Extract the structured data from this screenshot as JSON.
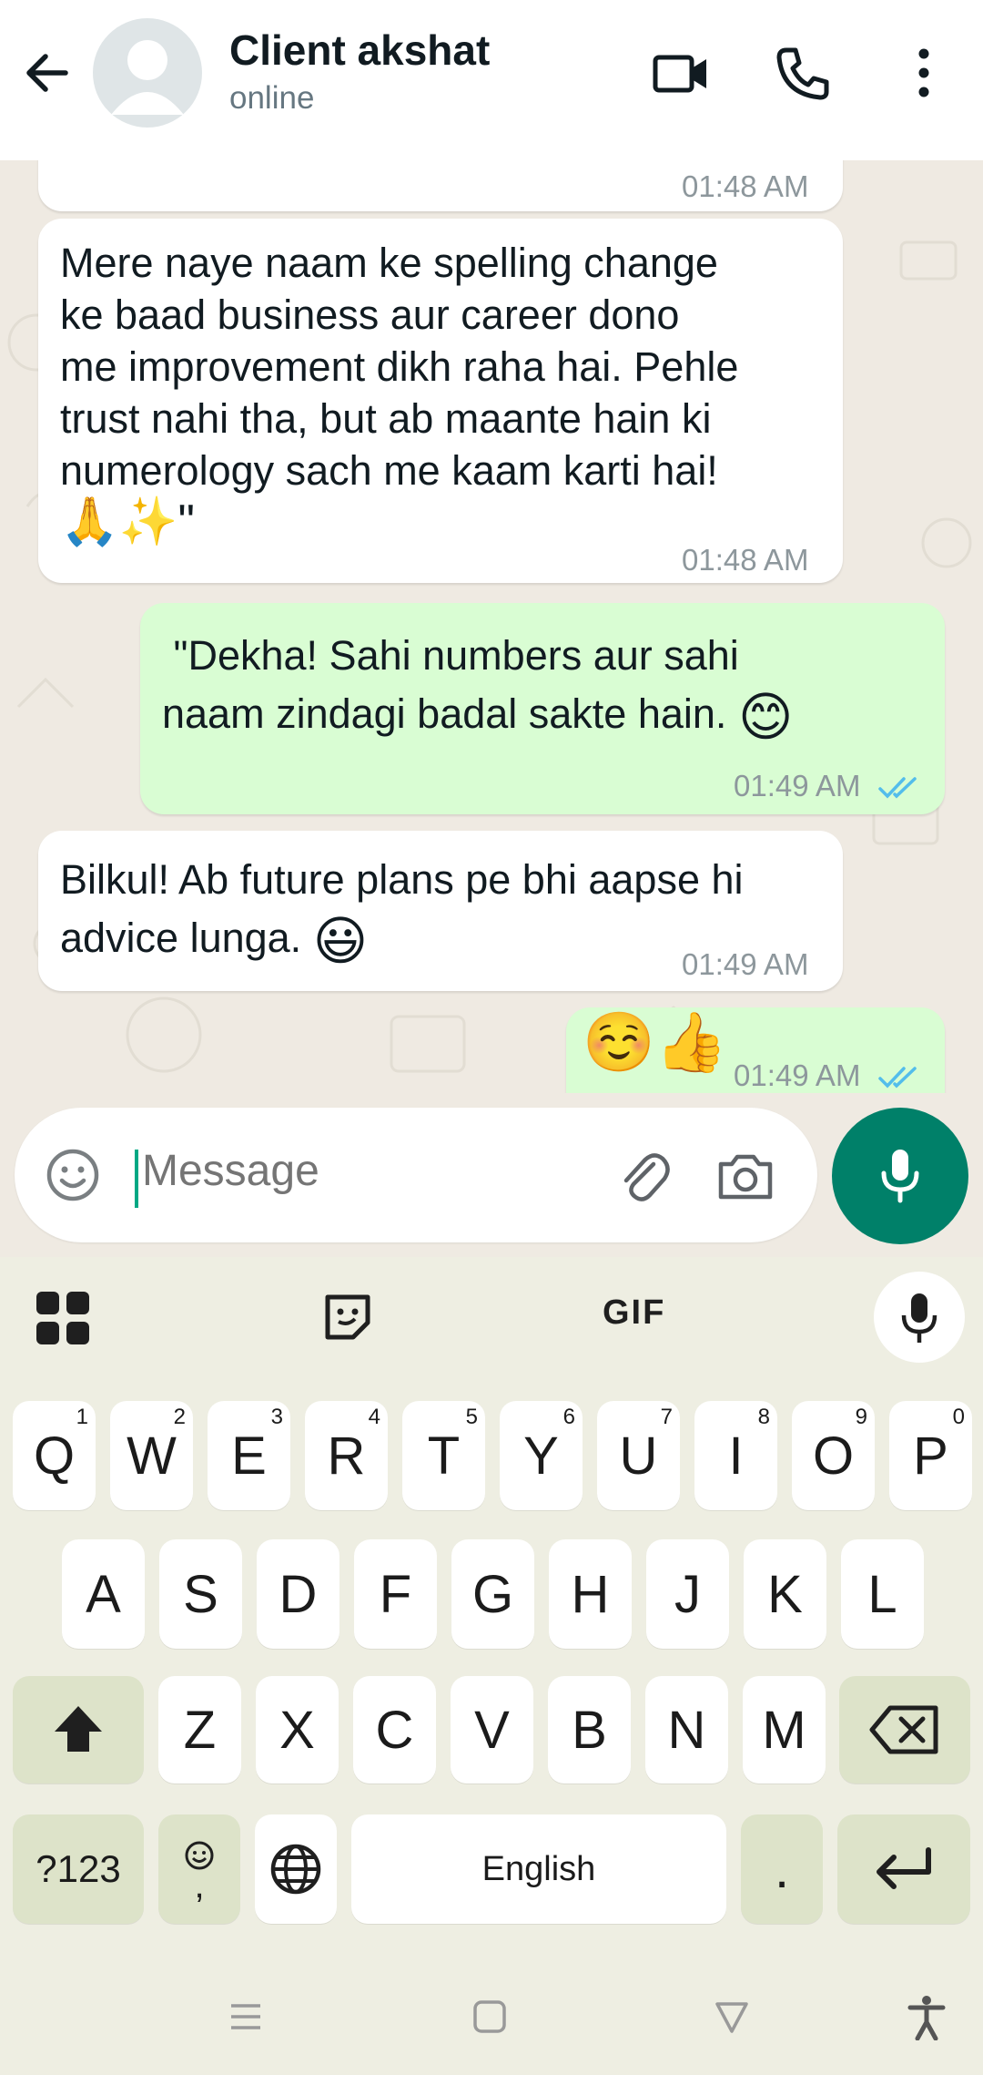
{
  "header": {
    "contact_name": "Client akshat",
    "status": "online"
  },
  "messages": [
    {
      "dir": "in",
      "time": "01:48 AM"
    },
    {
      "dir": "in",
      "lines": [
        "Mere naye naam ke spelling change",
        "ke baad business aur career dono",
        "me improvement dikh raha hai. Pehle",
        "trust nahi tha, but ab maante hain ki",
        "numerology sach me kaam karti hai!"
      ],
      "emoji_line": "🙏✨\"",
      "time": "01:48 AM"
    },
    {
      "dir": "out",
      "lines": [
        " \"Dekha! Sahi numbers aur sahi",
        "naam zindagi badal sakte hain."
      ],
      "emoji": "😊",
      "time": "01:49 AM"
    },
    {
      "dir": "in",
      "lines": [
        "Bilkul! Ab future plans pe bhi aapse hi",
        "advice lunga."
      ],
      "emoji": "😃",
      "time": "01:49 AM"
    },
    {
      "dir": "out",
      "emoji": "☺️👍",
      "time": "01:49 AM"
    }
  ],
  "input": {
    "placeholder": "Message"
  },
  "keyboard": {
    "gif_label": "GIF",
    "row1": [
      {
        "k": "Q",
        "n": "1"
      },
      {
        "k": "W",
        "n": "2"
      },
      {
        "k": "E",
        "n": "3"
      },
      {
        "k": "R",
        "n": "4"
      },
      {
        "k": "T",
        "n": "5"
      },
      {
        "k": "Y",
        "n": "6"
      },
      {
        "k": "U",
        "n": "7"
      },
      {
        "k": "I",
        "n": "8"
      },
      {
        "k": "O",
        "n": "9"
      },
      {
        "k": "P",
        "n": "0"
      }
    ],
    "row2": [
      "A",
      "S",
      "D",
      "F",
      "G",
      "H",
      "J",
      "K",
      "L"
    ],
    "row3": [
      "Z",
      "X",
      "C",
      "V",
      "B",
      "N",
      "M"
    ],
    "symbols_label": "?123",
    "comma_label": ",",
    "space_label": "English",
    "period_label": "."
  },
  "colors": {
    "accent": "#008069",
    "outgoing_bubble": "#d9fdd3",
    "read_ticks": "#53bdeb",
    "keyboard_bg": "#eeeee2",
    "func_key": "#dde3c9"
  }
}
